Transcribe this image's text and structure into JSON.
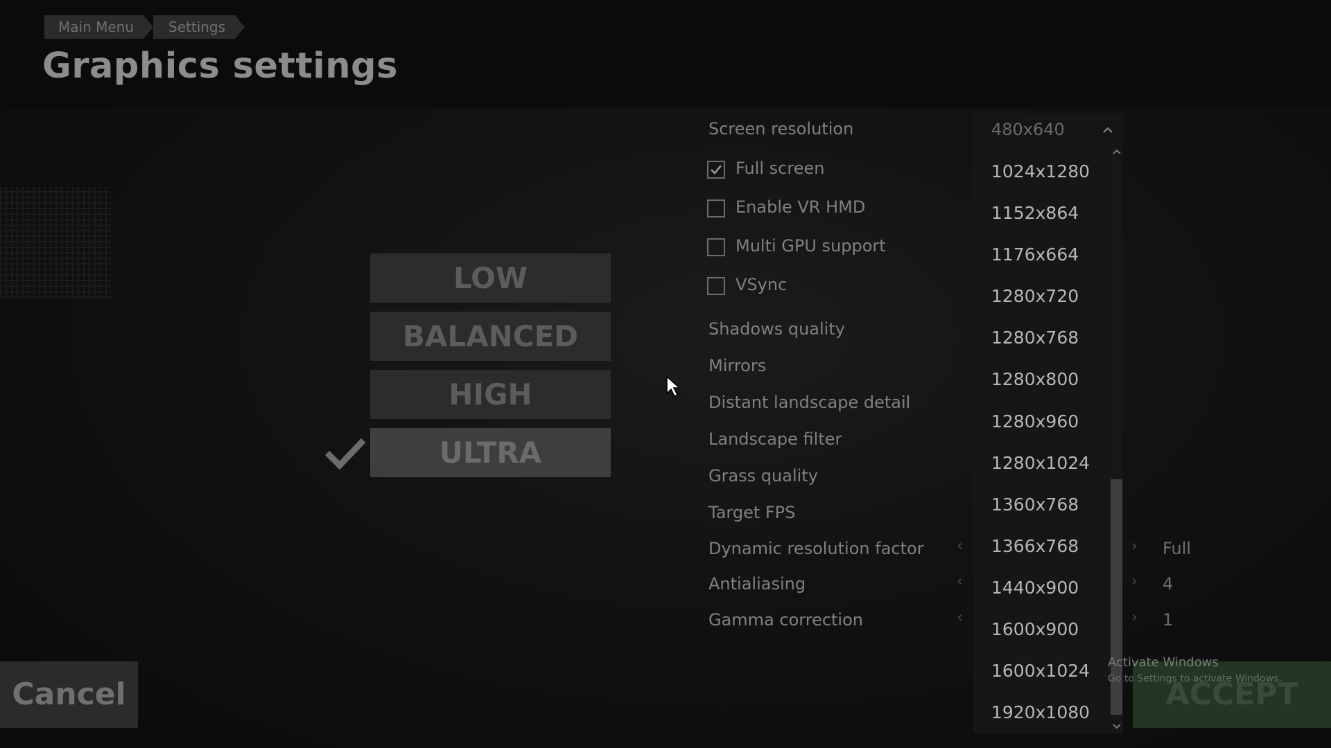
{
  "breadcrumb": [
    "Main Menu",
    "Settings"
  ],
  "title": "Graphics settings",
  "presets": [
    "LOW",
    "BALANCED",
    "HIGH",
    "ULTRA"
  ],
  "selected_preset": "ULTRA",
  "settings": {
    "screen_resolution": {
      "label": "Screen resolution",
      "value": "480x640"
    },
    "checkboxes": [
      {
        "label": "Full screen",
        "checked": true
      },
      {
        "label": "Enable VR HMD",
        "checked": false
      },
      {
        "label": "Multi GPU support",
        "checked": false
      },
      {
        "label": "VSync",
        "checked": false
      }
    ],
    "rows": [
      {
        "label": "Shadows quality"
      },
      {
        "label": "Mirrors"
      },
      {
        "label": "Distant landscape detail"
      },
      {
        "label": "Landscape filter"
      },
      {
        "label": "Grass quality"
      },
      {
        "label": "Target FPS"
      },
      {
        "label": "Dynamic resolution factor",
        "value": "Full"
      },
      {
        "label": "Antialiasing",
        "value": "4"
      },
      {
        "label": "Gamma correction",
        "value": "1"
      }
    ]
  },
  "resolution_options": [
    "1024x1280",
    "1152x864",
    "1176x664",
    "1280x720",
    "1280x768",
    "1280x800",
    "1280x960",
    "1280x1024",
    "1360x768",
    "1366x768",
    "1440x900",
    "1600x900",
    "1600x1024",
    "1920x1080"
  ],
  "buttons": {
    "cancel": "Cancel",
    "accept": "ACCEPT"
  },
  "watermark": {
    "title": "Activate Windows",
    "subtitle": "Go to Settings to activate Windows."
  },
  "colors": {
    "accept_bg": "#233523",
    "panel_bg": "#151616"
  }
}
